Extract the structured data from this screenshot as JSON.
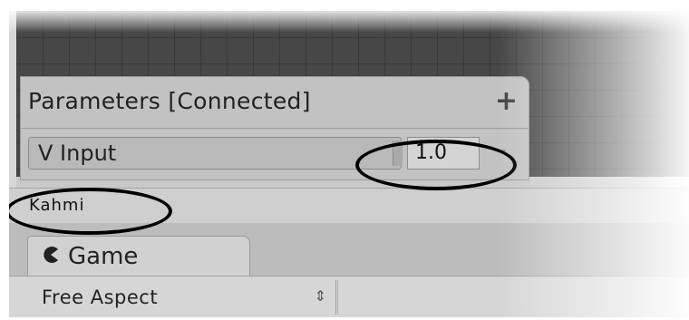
{
  "parameters_panel": {
    "title": "Parameters [Connected]",
    "add_icon": "+",
    "parameter": {
      "name": "V Input",
      "value": "1.0",
      "remove_icon": "−"
    }
  },
  "user_bar": {
    "name": "Kahmi"
  },
  "game_tab": {
    "icon": "pacman-icon",
    "label": "Game"
  },
  "toolbar": {
    "aspect": "Free Aspect",
    "aspect_arrows": "⇕"
  },
  "colors": {
    "grid_bg": "#474747",
    "panel_bg": "#c2c2c2",
    "annotation": "#000000"
  }
}
